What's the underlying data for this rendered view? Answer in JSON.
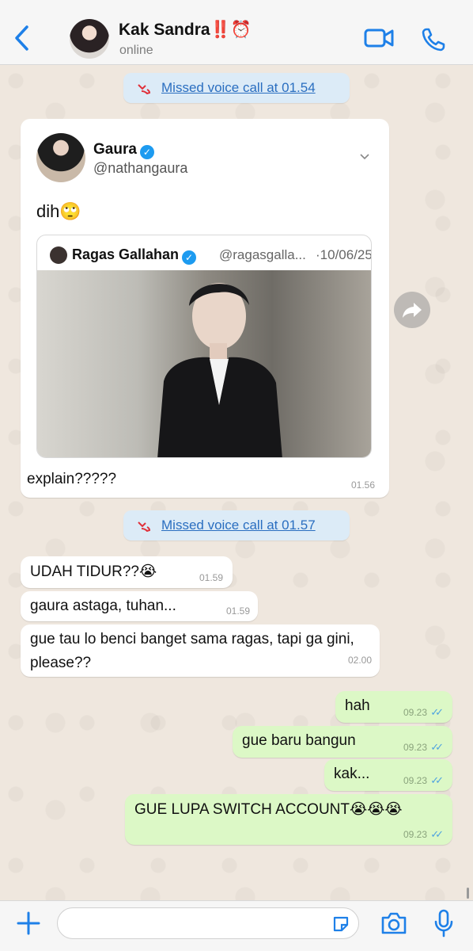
{
  "header": {
    "back_label": "",
    "contact_name": "Kak Sandra‼️⏰",
    "status": "online"
  },
  "messages": {
    "missed_call_1": "Missed voice call at 01.54",
    "missed_call_2": "Missed voice call at 01.57",
    "tweet": {
      "author_name": "Gaura",
      "author_handle": "@nathangaura",
      "text": "dih🙄",
      "quote_name": "Ragas Gallahan",
      "quote_handle": "@ragasgalla...",
      "quote_date": "·10/06/25"
    },
    "caption": "explain?????",
    "caption_time": "01.56",
    "in1": "UDAH TIDUR??😭",
    "in1_time": "01.59",
    "in2": "gaura astaga, tuhan...",
    "in2_time": "01.59",
    "in3": "gue tau lo benci banget sama ragas, tapi ga gini, please??",
    "in3_time": "02.00",
    "out1": "hah",
    "out1_time": "09.23",
    "out2": "gue baru bangun",
    "out2_time": "09.23",
    "out3": "kak...",
    "out3_time": "09.23",
    "out4": "GUE LUPA SWITCH ACCOUNT😭😭😭",
    "out4_time": "09.23"
  },
  "icons": {
    "back": "chevron-left-icon",
    "video": "video-call-icon",
    "phone": "phone-icon",
    "missed": "missed-call-icon",
    "forward": "forward-icon",
    "plus": "plus-icon",
    "sticker": "sticker-icon",
    "camera": "camera-icon",
    "mic": "microphone-icon"
  },
  "colors": {
    "accent": "#1e80e8",
    "outgoing_bubble": "#dcf8c6",
    "system_bubble": "#dcebf7",
    "read_ticks": "#4fa3e0"
  }
}
